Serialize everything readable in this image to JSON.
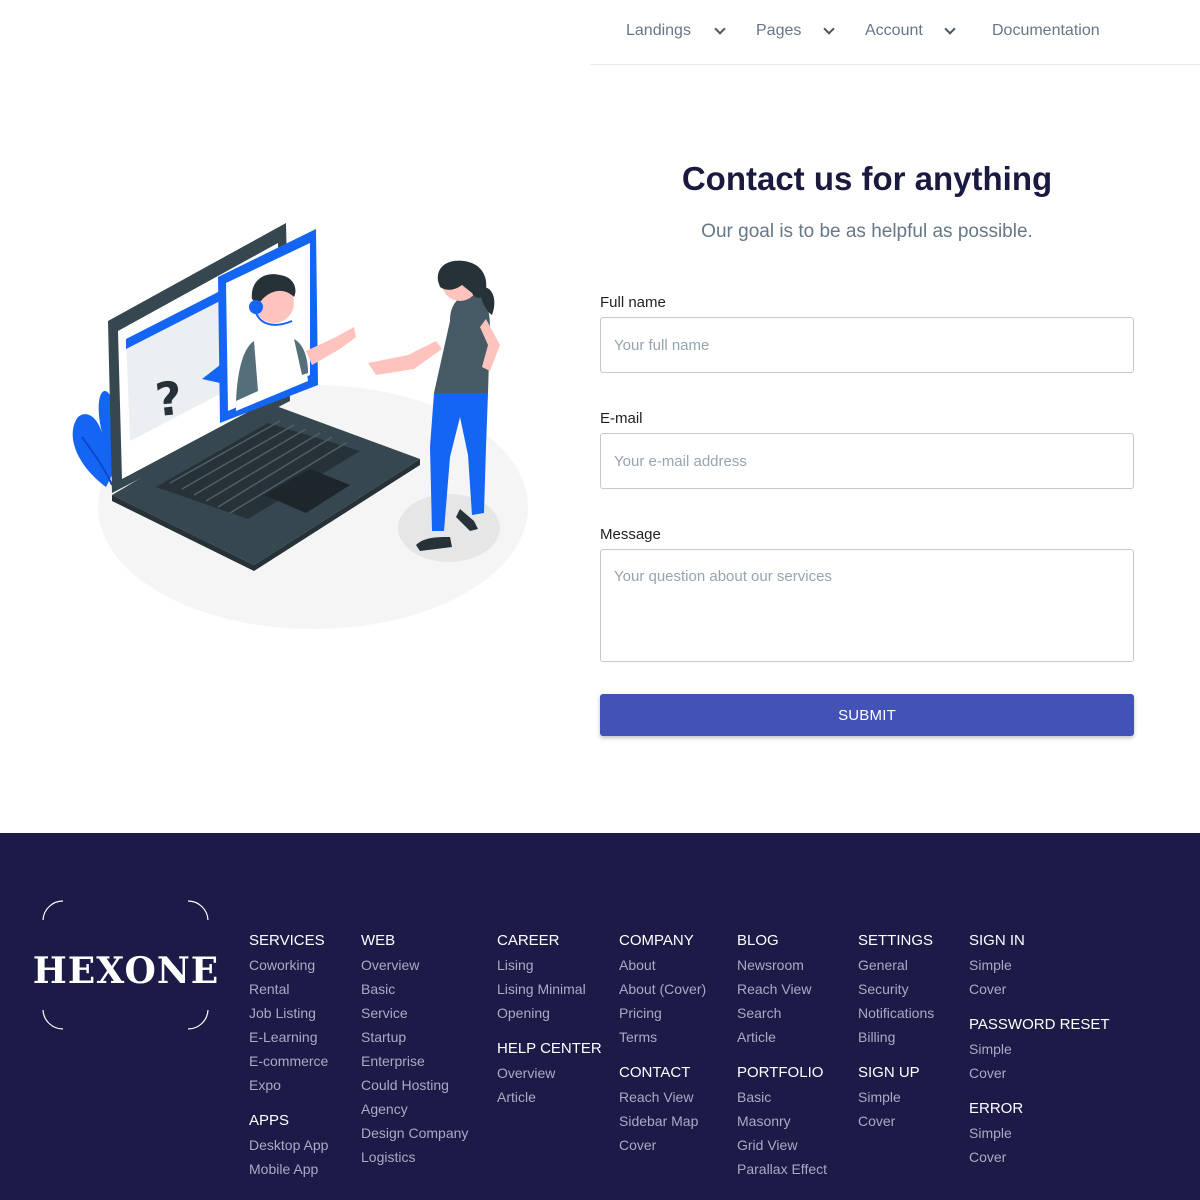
{
  "nav": {
    "items": [
      {
        "label": "Landings",
        "has_dropdown": true
      },
      {
        "label": "Pages",
        "has_dropdown": true
      },
      {
        "label": "Account",
        "has_dropdown": true
      },
      {
        "label": "Documentation",
        "has_dropdown": false
      }
    ]
  },
  "illustration": {
    "question_mark": "?"
  },
  "contact": {
    "title": "Contact us for anything",
    "subtitle": "Our goal is to be as helpful as possible.",
    "full_name_label": "Full name",
    "full_name_placeholder": "Your full name",
    "full_name_value": "",
    "email_label": "E-mail",
    "email_placeholder": "Your e-mail address",
    "email_value": "",
    "message_label": "Message",
    "message_placeholder": "Your question about our services",
    "message_value": "",
    "submit_label": "SUBMIT"
  },
  "footer": {
    "logo_text": "HEXONE",
    "columns": [
      {
        "sections": [
          {
            "heading": "SERVICES",
            "links": [
              "Coworking",
              "Rental",
              "Job Listing",
              "E-Learning",
              "E-commerce",
              "Expo"
            ]
          },
          {
            "heading": "APPS",
            "links": [
              "Desktop App",
              "Mobile App"
            ]
          }
        ]
      },
      {
        "sections": [
          {
            "heading": "WEB",
            "links": [
              "Overview",
              "Basic",
              "Service",
              "Startup",
              "Enterprise",
              "Could Hosting",
              "Agency",
              "Design Company",
              "Logistics"
            ]
          }
        ]
      },
      {
        "sections": [
          {
            "heading": "CAREER",
            "links": [
              "Lising",
              "Lising Minimal",
              "Opening"
            ]
          },
          {
            "heading": "HELP CENTER",
            "links": [
              "Overview",
              "Article"
            ]
          }
        ]
      },
      {
        "sections": [
          {
            "heading": "COMPANY",
            "links": [
              "About",
              "About (Cover)",
              "Pricing",
              "Terms"
            ]
          },
          {
            "heading": "CONTACT",
            "links": [
              "Reach View",
              "Sidebar Map",
              "Cover"
            ]
          }
        ]
      },
      {
        "sections": [
          {
            "heading": "BLOG",
            "links": [
              "Newsroom",
              "Reach View",
              "Search",
              "Article"
            ]
          },
          {
            "heading": "PORTFOLIO",
            "links": [
              "Basic",
              "Masonry",
              "Grid View",
              "Parallax Effect"
            ]
          }
        ]
      },
      {
        "sections": [
          {
            "heading": "SETTINGS",
            "links": [
              "General",
              "Security",
              "Notifications",
              "Billing"
            ]
          },
          {
            "heading": "SIGN UP",
            "links": [
              "Simple",
              "Cover"
            ]
          }
        ]
      },
      {
        "sections": [
          {
            "heading": "SIGN IN",
            "links": [
              "Simple",
              "Cover"
            ]
          },
          {
            "heading": "PASSWORD RESET",
            "links": [
              "Simple",
              "Cover"
            ]
          },
          {
            "heading": "ERROR",
            "links": [
              "Simple",
              "Cover"
            ]
          }
        ]
      }
    ]
  },
  "colors": {
    "accent": "#4352b5",
    "footer_bg": "#1c1a47",
    "title": "#1a1a40",
    "illustration_blue": "#1565f5",
    "laptop_dark": "#37474f"
  }
}
